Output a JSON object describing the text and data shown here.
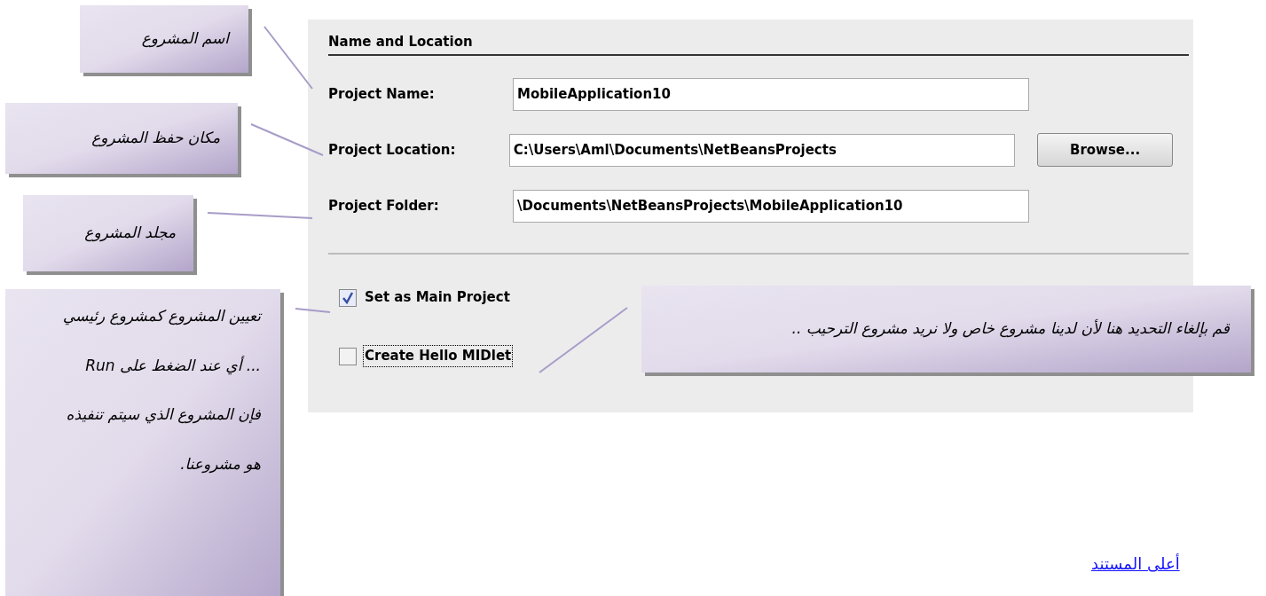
{
  "callouts": [
    {
      "lines": [
        "اسم المشروع"
      ]
    },
    {
      "lines": [
        "مكان حفظ المشروع"
      ]
    },
    {
      "lines": [
        "مجلد المشروع"
      ]
    },
    {
      "lines": [
        "تعيين المشروع كمشروع رئيسي",
        "... أي عند الضغط على  Run",
        "فإن المشروع الذي سيتم تنفيذه",
        "هو مشروعنا."
      ]
    },
    {
      "lines": [
        "قم بإلغاء التحديد هنا لأن لدينا مشروع خاص ولا نريد مشروع الترحيب .."
      ]
    }
  ],
  "dialog": {
    "heading": "Name and Location",
    "fields": [
      {
        "label": "Project Name:",
        "value": "MobileApplication10"
      },
      {
        "label": "Project Location:",
        "value": "C:\\Users\\Aml\\Documents\\NetBeansProjects"
      },
      {
        "label": "Project Folder:",
        "value": "\\Documents\\NetBeansProjects\\MobileApplication10"
      }
    ],
    "browse_button": "Browse...",
    "checkboxes": [
      {
        "label": "Set as Main Project",
        "checked": true,
        "focused": false
      },
      {
        "label": "Create Hello MIDlet",
        "checked": false,
        "focused": true
      }
    ]
  },
  "link": "أعلى المستند"
}
